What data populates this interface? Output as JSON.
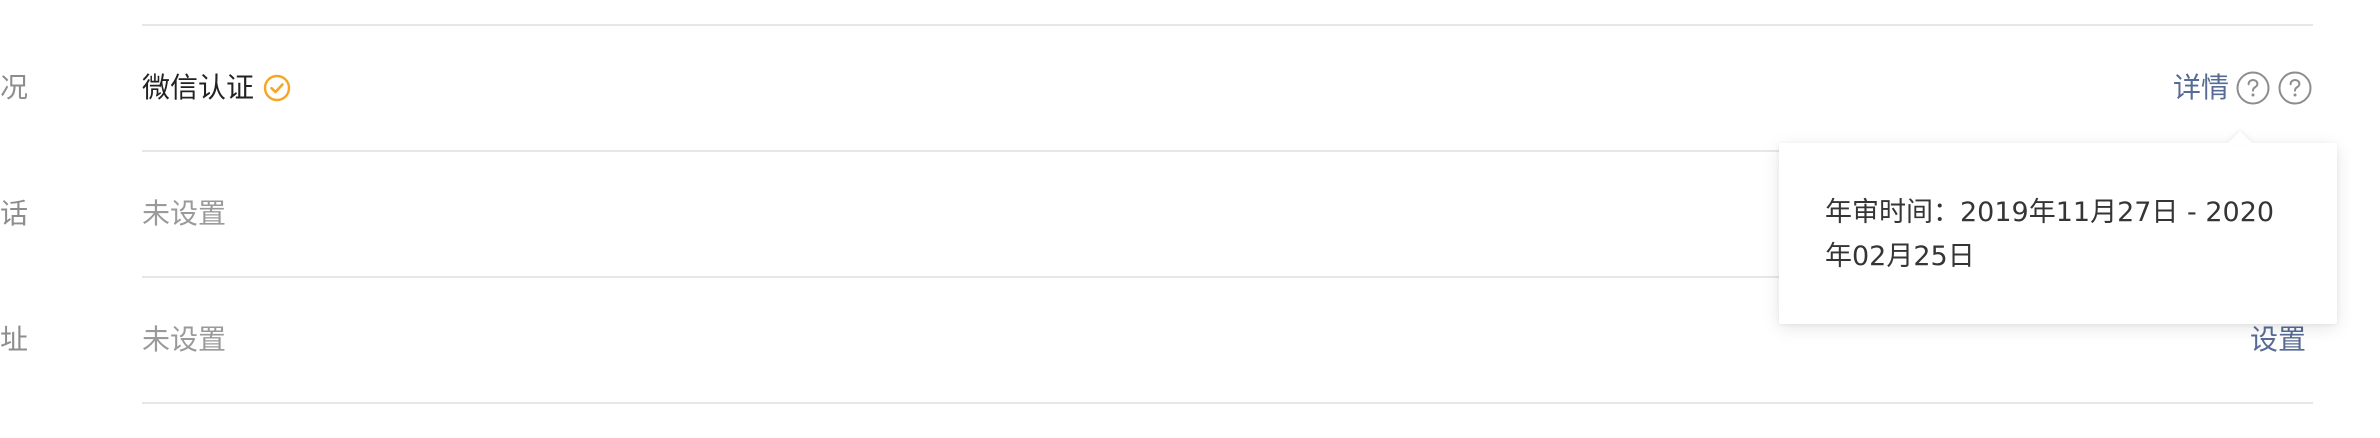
{
  "rows": [
    {
      "label": "况",
      "value": "微信认证",
      "verified": true,
      "action": "详情"
    },
    {
      "label": "话",
      "value": "未设置"
    },
    {
      "label": "址",
      "value": "未设置",
      "action": "设置"
    }
  ],
  "popover": {
    "text": "年审时间：2019年11月27日 - 2020年02月25日"
  },
  "icons": {
    "verified": "verified-check-icon",
    "help": "question-circle-icon"
  },
  "colors": {
    "link": "#576b95",
    "verified": "#f5a623",
    "divider": "#e7e7eb",
    "muted_text": "#9a9a9a"
  }
}
